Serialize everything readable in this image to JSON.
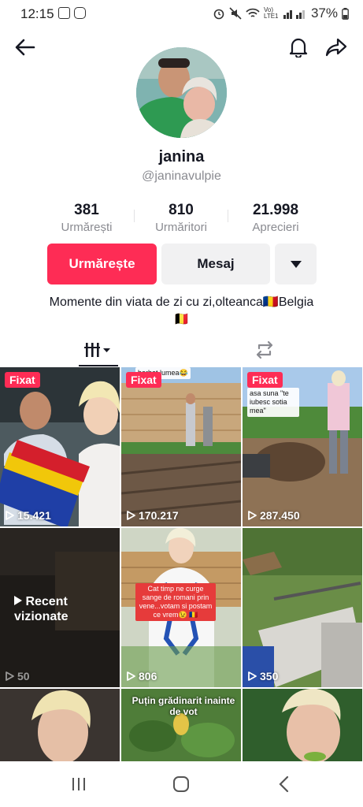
{
  "status": {
    "time": "12:15",
    "battery": "37%",
    "network_label": "Vo) LTE1"
  },
  "profile": {
    "name": "janina",
    "handle": "@janinavulpie"
  },
  "stats": [
    {
      "value": "381",
      "label": "Urmărești"
    },
    {
      "value": "810",
      "label": "Urmăritori"
    },
    {
      "value": "21.998",
      "label": "Aprecieri"
    }
  ],
  "actions": {
    "follow": "Urmărește",
    "message": "Mesaj"
  },
  "bio": {
    "line1": "Momente din viata de zi cu zi,olteanca🇷🇴Belgia",
    "line2": "🇧🇪"
  },
  "videos": [
    {
      "pinned": "Fixat",
      "views": "15.421"
    },
    {
      "pinned": "Fixat",
      "views": "170.217",
      "caption": "barbat lumea😂"
    },
    {
      "pinned": "Fixat",
      "views": "287.450",
      "caption": "asa suna \"te iubesc sotia mea\""
    },
    {
      "recent": "Recent vizionate",
      "views": "50"
    },
    {
      "views": "806",
      "caption": "Cat timp ne curge sange de romani prin vene...votam si postam ce vrem😉 🇷🇴"
    },
    {
      "views": "350"
    },
    {},
    {
      "caption": "Puțin grădinarit inainte de vot"
    },
    {}
  ],
  "colors": {
    "accent": "#fe2c55",
    "button_gray": "#f1f1f2",
    "muted_text": "#8a8b91"
  }
}
